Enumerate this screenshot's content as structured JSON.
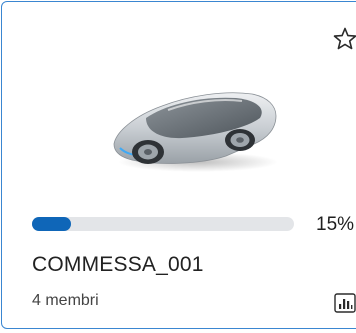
{
  "card": {
    "title": "COMMESSA_001",
    "members": "4 membri",
    "progress_percent_label": "15%",
    "progress_value": 0.15,
    "thumbnail": "concept-car-image",
    "favorite_icon": "star-outline-icon",
    "stats_icon": "bar-chart-icon"
  },
  "colors": {
    "border": "#3a86d1",
    "progress_fill": "#0f66b8",
    "progress_track": "#e3e5e8"
  }
}
